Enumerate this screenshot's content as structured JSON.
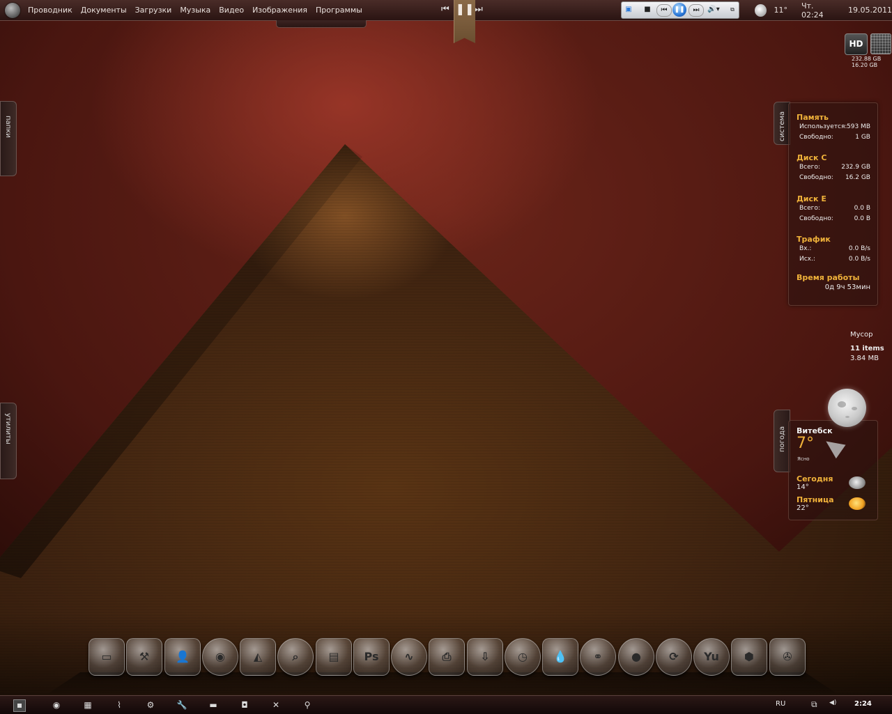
{
  "topbar": {
    "menu": [
      "Проводник",
      "Документы",
      "Загрузки",
      "Музыка",
      "Видео",
      "Изображения",
      "Программы"
    ],
    "temp": "11°",
    "day_time": "Чт. 02:24",
    "date": "19.05.2011"
  },
  "sidetabs": {
    "left_top": "папки",
    "left_bottom": "утилиты",
    "right_system": "система",
    "right_weather": "погода"
  },
  "hd": {
    "label": "HD",
    "total": "232.88 GB",
    "free": "16.20 GB"
  },
  "system": {
    "memory": {
      "title": "Память",
      "used_label": "Используется:",
      "used": "593 MB",
      "free_label": "Свободно:",
      "free": "1 GB"
    },
    "disk_c": {
      "title": "Диск C",
      "total_label": "Всего:",
      "total": "232.9 GB",
      "free_label": "Свободно:",
      "free": "16.2 GB"
    },
    "disk_e": {
      "title": "Диск E",
      "total_label": "Всего:",
      "total": "0.0 B",
      "free_label": "Свободно:",
      "free": "0.0 B"
    },
    "traffic": {
      "title": "Трафик",
      "in_label": "Вх.:",
      "in": "0.0 B/s",
      "out_label": "Исх.:",
      "out": "0.0 B/s"
    },
    "uptime": {
      "title": "Время работы",
      "value": "0д 9ч 53мин"
    }
  },
  "trash": {
    "title": "Мусор",
    "items": "11 items",
    "size": "3.84 MB"
  },
  "weather": {
    "city": "Витебск",
    "temp": "7°",
    "condition": "Ясно",
    "today": {
      "label": "Сегодня",
      "temp": "14°"
    },
    "friday": {
      "label": "Пятница",
      "temp": "22°"
    }
  },
  "dock": {
    "icons": [
      "computer-icon",
      "tools-icon",
      "user-icon",
      "firefox-icon",
      "dreamweaver-icon",
      "search-icon",
      "floppy-icon",
      "photoshop-icon",
      "activity-monitor-icon",
      "printer-icon",
      "installer-icon",
      "clock-icon",
      "drop-icon",
      "network-icon",
      "ball-icon",
      "cleaner-icon",
      "yu-icon",
      "hexagons-icon",
      "trefoil-icon"
    ],
    "ps_text": "Ps",
    "yu_text": "Yu"
  },
  "taskbar": {
    "lang": "RU",
    "time": "2:24"
  },
  "colors": {
    "accent": "#f0b23a"
  }
}
